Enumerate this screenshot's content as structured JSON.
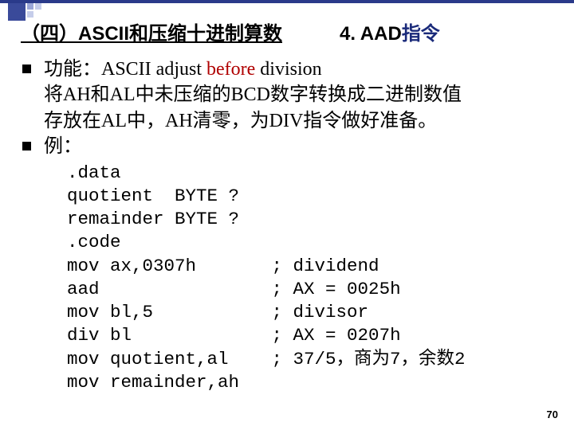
{
  "title": {
    "left": "（四）ASCII和压缩十进制算数",
    "right_prefix": "4. AAD",
    "right_suffix": "指令"
  },
  "bullets": [
    {
      "kind": "func",
      "prefix": "功能：ASCII adjust ",
      "before": "before",
      "suffix": " division",
      "line2": "将AH和AL中未压缩的BCD数字转换成二进制数值",
      "line3": "存放在AL中，AH清零，为DIV指令做好准备。"
    },
    {
      "kind": "example",
      "label": "例："
    }
  ],
  "code": ".data\nquotient  BYTE ?\nremainder BYTE ?\n.code\nmov ax,0307h       ; dividend\naad                ; AX = 0025h\nmov bl,5           ; divisor\ndiv bl             ; AX = 0207h\nmov quotient,al    ; 37/5，商为7，余数2\nmov remainder,ah",
  "page": "70"
}
